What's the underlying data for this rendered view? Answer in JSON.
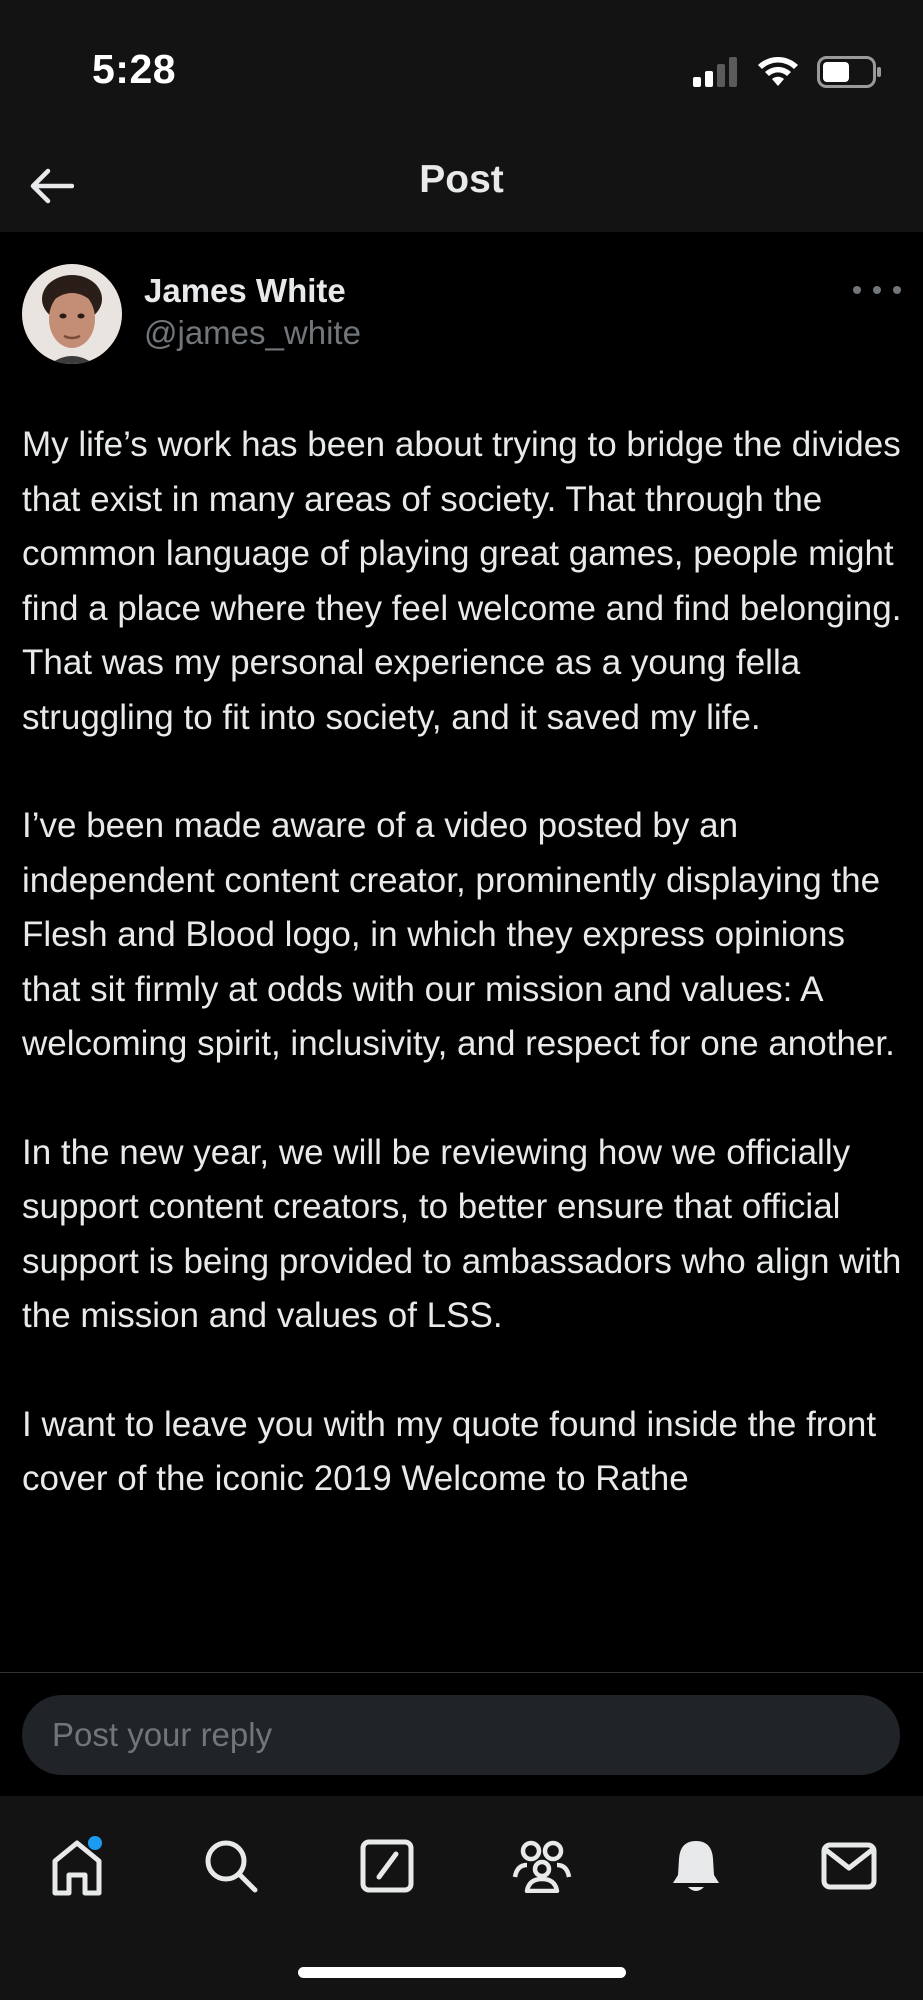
{
  "status_bar": {
    "time": "5:28",
    "icons": [
      "cellular-signal-icon",
      "wifi-icon",
      "battery-icon"
    ]
  },
  "header": {
    "back_icon": "arrow-left-icon",
    "title": "Post"
  },
  "post": {
    "author_name": "James White",
    "author_handle": "@james_white",
    "more_icon": "ellipsis-icon",
    "paragraphs": [
      "My life’s work has been about trying to bridge the divides that exist in many areas of society. That through the common language of playing great games, people might find a place where they feel welcome and find belonging. That was my personal experience as a young fella struggling to fit into society, and it saved my life.",
      "I’ve been made aware of a video posted by an independent content creator, prominently displaying the Flesh and Blood logo, in which they express opinions that sit firmly at odds with our mission and values: A welcoming spirit, inclusivity, and respect for one another.",
      "In the new year, we will be reviewing how we officially support content creators, to better ensure that official support is being provided to ambassadors who align with the mission and values of LSS.",
      "I want to leave you with my quote found inside the front cover of the iconic 2019 Welcome to Rathe"
    ]
  },
  "reply": {
    "placeholder": "Post your reply"
  },
  "tab_bar": {
    "tabs": [
      "home-icon",
      "search-icon",
      "compose-icon",
      "communities-icon",
      "notifications-icon",
      "messages-icon"
    ],
    "home_has_notification_dot": true
  },
  "colors": {
    "background": "#000000",
    "bar_background": "#131313",
    "text_primary": "#e7e9ea",
    "text_secondary": "#71767b",
    "accent_blue": "#1d9bf0",
    "input_background": "#202327"
  }
}
